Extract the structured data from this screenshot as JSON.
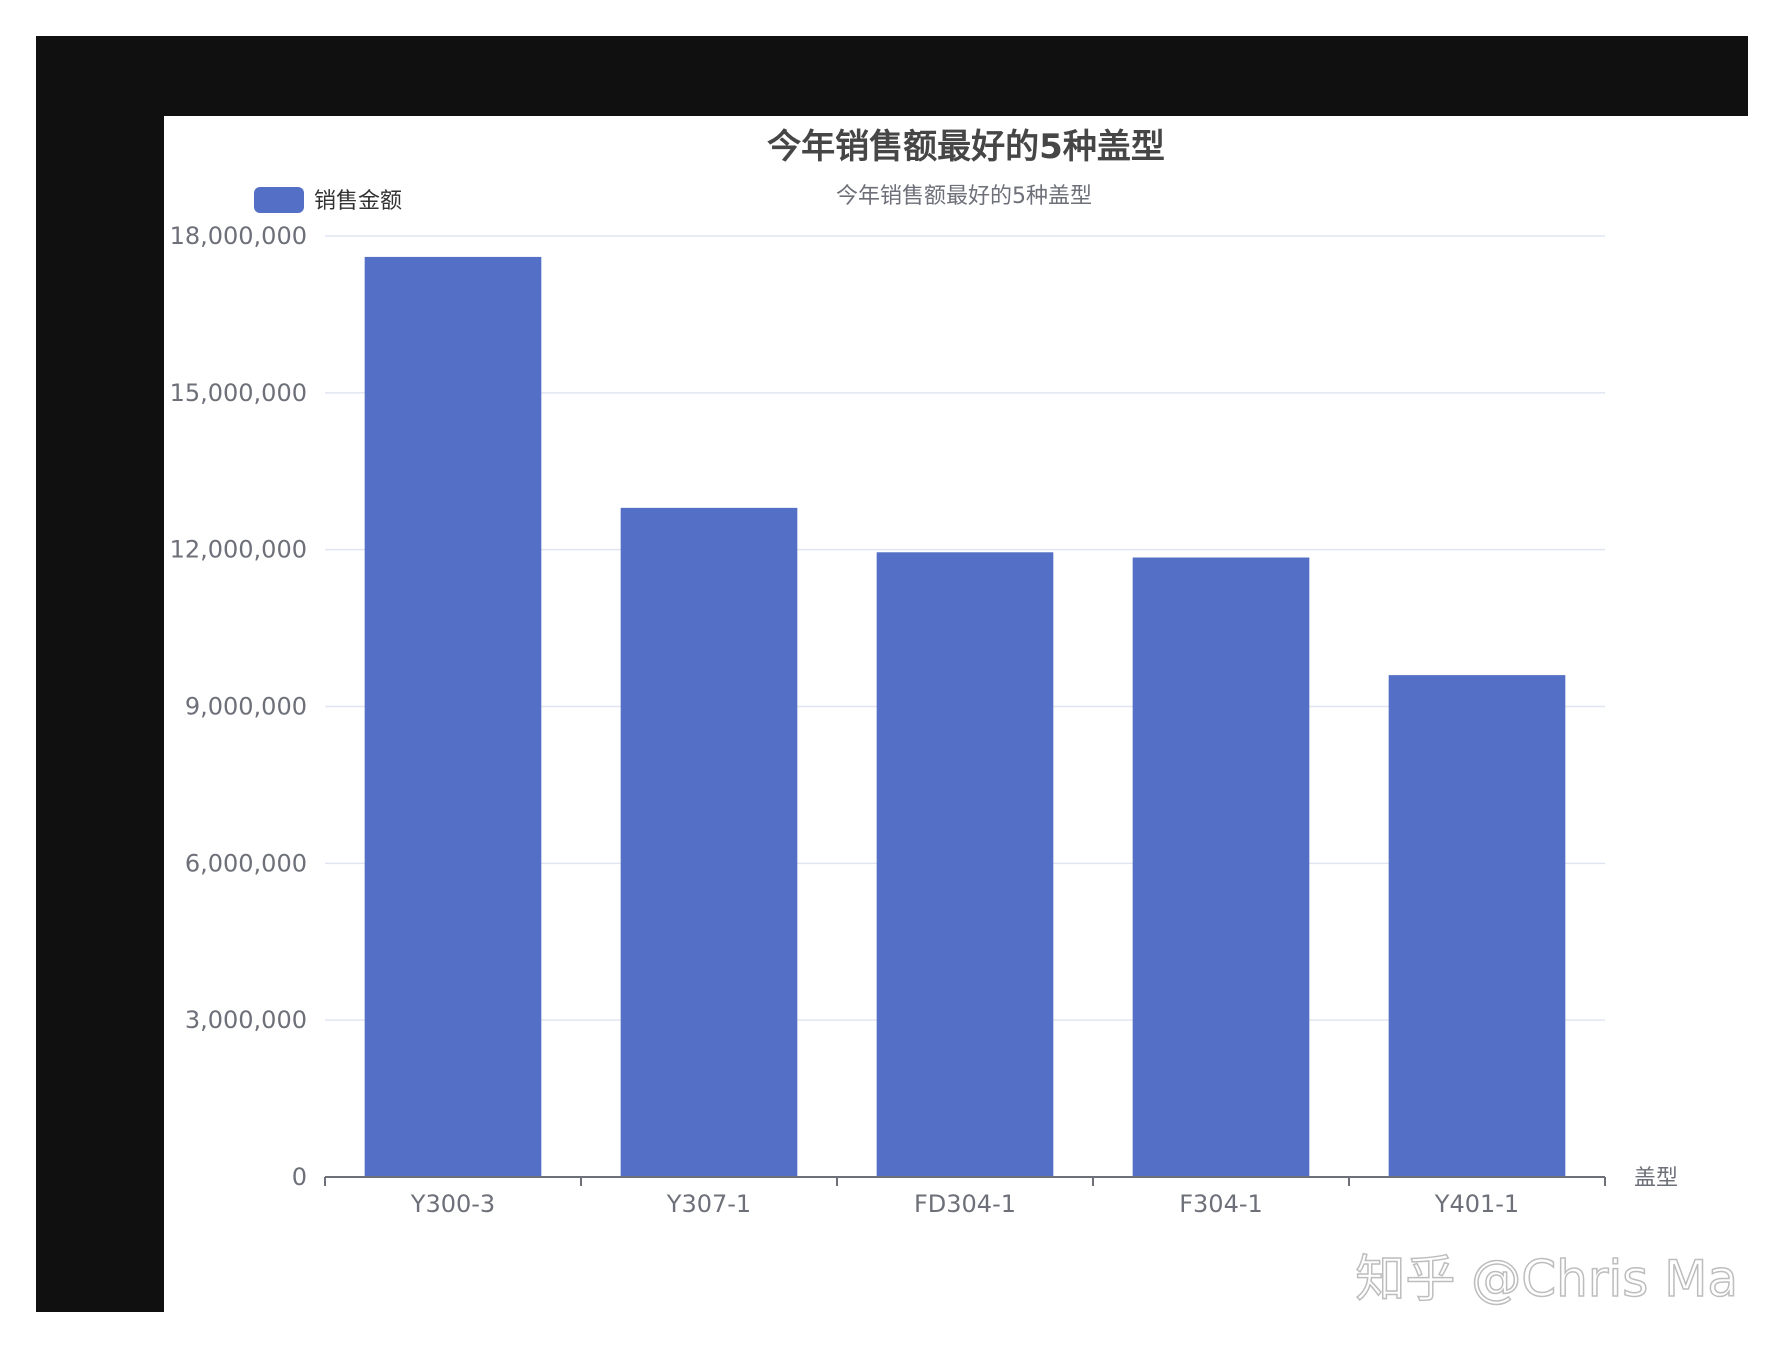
{
  "chart_data": {
    "type": "bar",
    "title": "今年销售额最好的5种盖型",
    "subtitle": "今年销售额最好的5种盖型",
    "xlabel": "盖型",
    "ylabel": "",
    "categories": [
      "Y300-3",
      "Y307-1",
      "FD304-1",
      "F304-1",
      "Y401-1"
    ],
    "series": [
      {
        "name": "销售金额",
        "values": [
          17600000,
          12800000,
          11950000,
          11850000,
          9600000
        ],
        "color": "#5470c6"
      }
    ],
    "ylim": [
      0,
      18000000
    ],
    "yticks": [
      0,
      3000000,
      6000000,
      9000000,
      12000000,
      15000000,
      18000000
    ],
    "ytick_labels": [
      "0",
      "3,000,000",
      "6,000,000",
      "9,000,000",
      "12,000,000",
      "15,000,000",
      "18,000,000"
    ],
    "grid": true,
    "legend": {
      "position": "top-left",
      "entries": [
        "销售金额"
      ]
    }
  },
  "watermark": "知乎 @Chris Ma",
  "colors": {
    "bar": "#5470c6",
    "grid": "#e0e6f1",
    "axis": "#6e7079",
    "frame": "#101010"
  }
}
